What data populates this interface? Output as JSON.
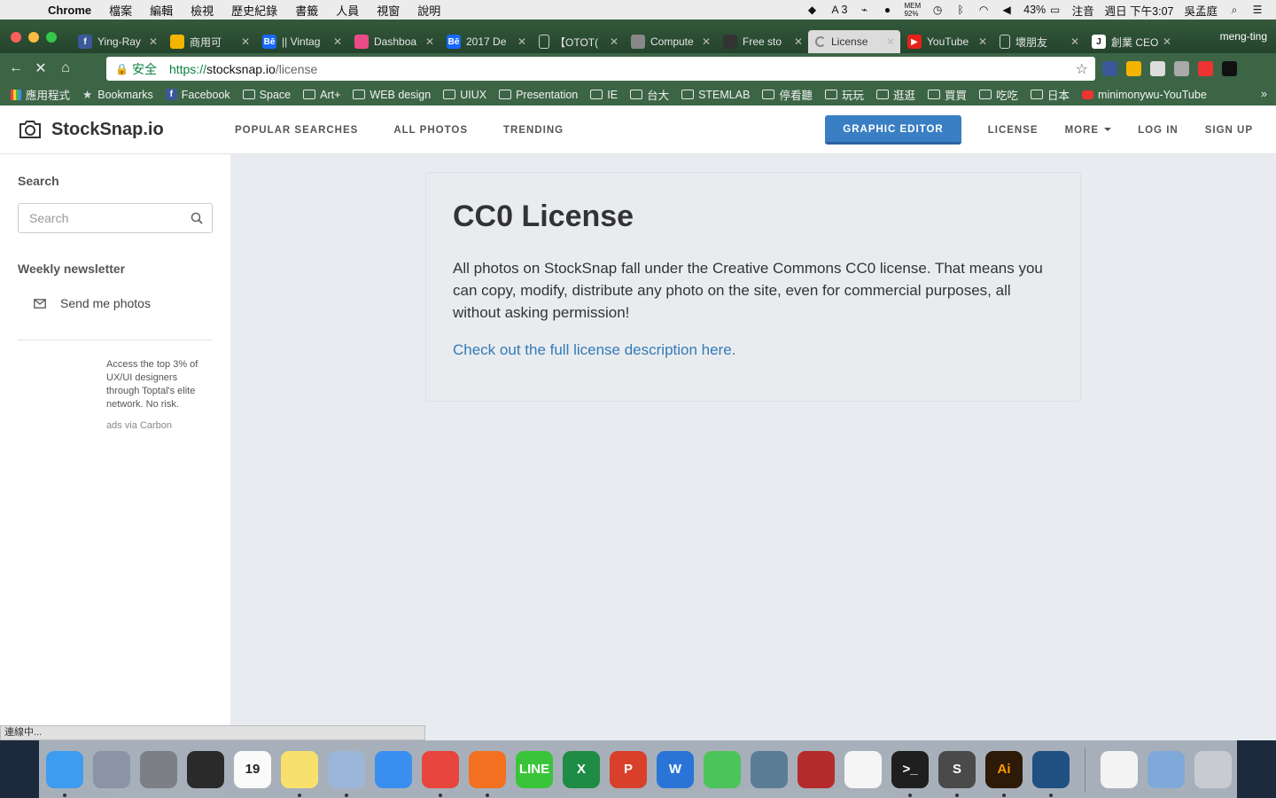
{
  "menubar": {
    "app": "Chrome",
    "menus": [
      "檔案",
      "編輯",
      "檢視",
      "歷史紀錄",
      "書籤",
      "人員",
      "視窗",
      "說明"
    ],
    "status": {
      "badge_count": "3",
      "mem": "MEM",
      "mem_pct": "92%",
      "battery": "43%",
      "input_method": "注音",
      "datetime": "週日 下午3:07",
      "user": "吳孟庭"
    }
  },
  "tabs": [
    {
      "label": "Ying-Ray",
      "icon": "facebook-icon",
      "color": "#3b5998",
      "glyph": "f"
    },
    {
      "label": "商用可",
      "icon": "drive-icon",
      "color": "#f4b400",
      "glyph": ""
    },
    {
      "label": "|| Vintag",
      "icon": "behance-icon",
      "color": "#1769ff",
      "glyph": "Bē"
    },
    {
      "label": "Dashboa",
      "icon": "dribbble-icon",
      "color": "#ea4c89",
      "glyph": ""
    },
    {
      "label": "2017 De",
      "icon": "behance-icon",
      "color": "#1769ff",
      "glyph": "Bē"
    },
    {
      "label": "【OTOT(",
      "icon": "page-icon",
      "color": "transparent",
      "glyph": ""
    },
    {
      "label": "Compute",
      "icon": "gear-icon",
      "color": "#888888",
      "glyph": ""
    },
    {
      "label": "Free sto",
      "icon": "camera-icon",
      "color": "#333333",
      "glyph": ""
    },
    {
      "label": "License",
      "icon": "loading-icon",
      "color": "transparent",
      "glyph": "",
      "active": true
    },
    {
      "label": "YouTube",
      "icon": "youtube-icon",
      "color": "#e62117",
      "glyph": "▶"
    },
    {
      "label": "壞朋友",
      "icon": "page-icon",
      "color": "transparent",
      "glyph": ""
    },
    {
      "label": "創業 CEO",
      "icon": "j-icon",
      "color": "#ffffff",
      "glyph": "J"
    }
  ],
  "profile": "meng-ting",
  "addressbar": {
    "secure": "安全",
    "scheme": "https://",
    "host": "stocksnap.io",
    "path": "/license"
  },
  "bookmarks": {
    "apps": "應用程式",
    "items": [
      "Bookmarks",
      "Facebook",
      "Space",
      "Art+",
      "WEB design",
      "UIUX",
      "Presentation",
      "IE",
      "台大",
      "STEMLAB",
      "停看聽",
      "玩玩",
      "逛逛",
      "買買",
      "吃吃",
      "日本",
      "minimonywu-YouTube"
    ],
    "more": "»"
  },
  "site": {
    "logo": "StockSnap.io",
    "nav": [
      "POPULAR SEARCHES",
      "ALL PHOTOS",
      "TRENDING"
    ],
    "editor_button": "GRAPHIC EDITOR",
    "license": "LICENSE",
    "more": "MORE",
    "login": "LOG IN",
    "signup": "SIGN UP"
  },
  "sidebar": {
    "search_heading": "Search",
    "search_placeholder": "Search",
    "newsletter_heading": "Weekly newsletter",
    "newsletter_link": "Send me photos",
    "ad_text": "Access the top 3% of UX/UI designers through Toptal's elite network. No risk.",
    "ad_by": "ads via Carbon"
  },
  "main": {
    "title": "CC0 License",
    "body": "All photos on StockSnap fall under the Creative Commons CC0 license. That means you can copy, modify, distribute any photo on the site, even for commercial purposes, all without asking permission!",
    "link": "Check out the full license description here."
  },
  "statusbar": "連線中...",
  "dock": [
    {
      "name": "finder",
      "color": "#3e9cf0"
    },
    {
      "name": "launchpad",
      "color": "#8a94a6"
    },
    {
      "name": "system-preferences",
      "color": "#7c7f86"
    },
    {
      "name": "activity-monitor",
      "color": "#2a2a2a"
    },
    {
      "name": "calendar",
      "color": "#fafafa",
      "text": "19"
    },
    {
      "name": "notes",
      "color": "#f7e16c"
    },
    {
      "name": "preview",
      "color": "#9bb6d8"
    },
    {
      "name": "safari",
      "color": "#3a8ef0"
    },
    {
      "name": "chrome",
      "color": "#e8453c"
    },
    {
      "name": "firefox",
      "color": "#f2701f"
    },
    {
      "name": "line",
      "color": "#3ac43a",
      "text": "LINE"
    },
    {
      "name": "excel",
      "color": "#1e8c44",
      "text": "X"
    },
    {
      "name": "powerpoint",
      "color": "#d9402b",
      "text": "P"
    },
    {
      "name": "word",
      "color": "#2a74d8",
      "text": "W"
    },
    {
      "name": "facetime",
      "color": "#4bc45a"
    },
    {
      "name": "image-capture",
      "color": "#5b7d94"
    },
    {
      "name": "photo-booth",
      "color": "#b52b2b"
    },
    {
      "name": "photos",
      "color": "#f5f5f5"
    },
    {
      "name": "terminal",
      "color": "#1f1f1f",
      "text": ">_"
    },
    {
      "name": "sublime-text",
      "color": "#4a4a4a",
      "text": "S"
    },
    {
      "name": "illustrator",
      "color": "#2d1a07",
      "text": "Ai"
    },
    {
      "name": "sourcetree",
      "color": "#205081"
    },
    {
      "name": "document",
      "color": "#f3f3f3"
    },
    {
      "name": "downloads-folder",
      "color": "#7fa9d8"
    },
    {
      "name": "trash",
      "color": "#c8ccd2"
    }
  ]
}
